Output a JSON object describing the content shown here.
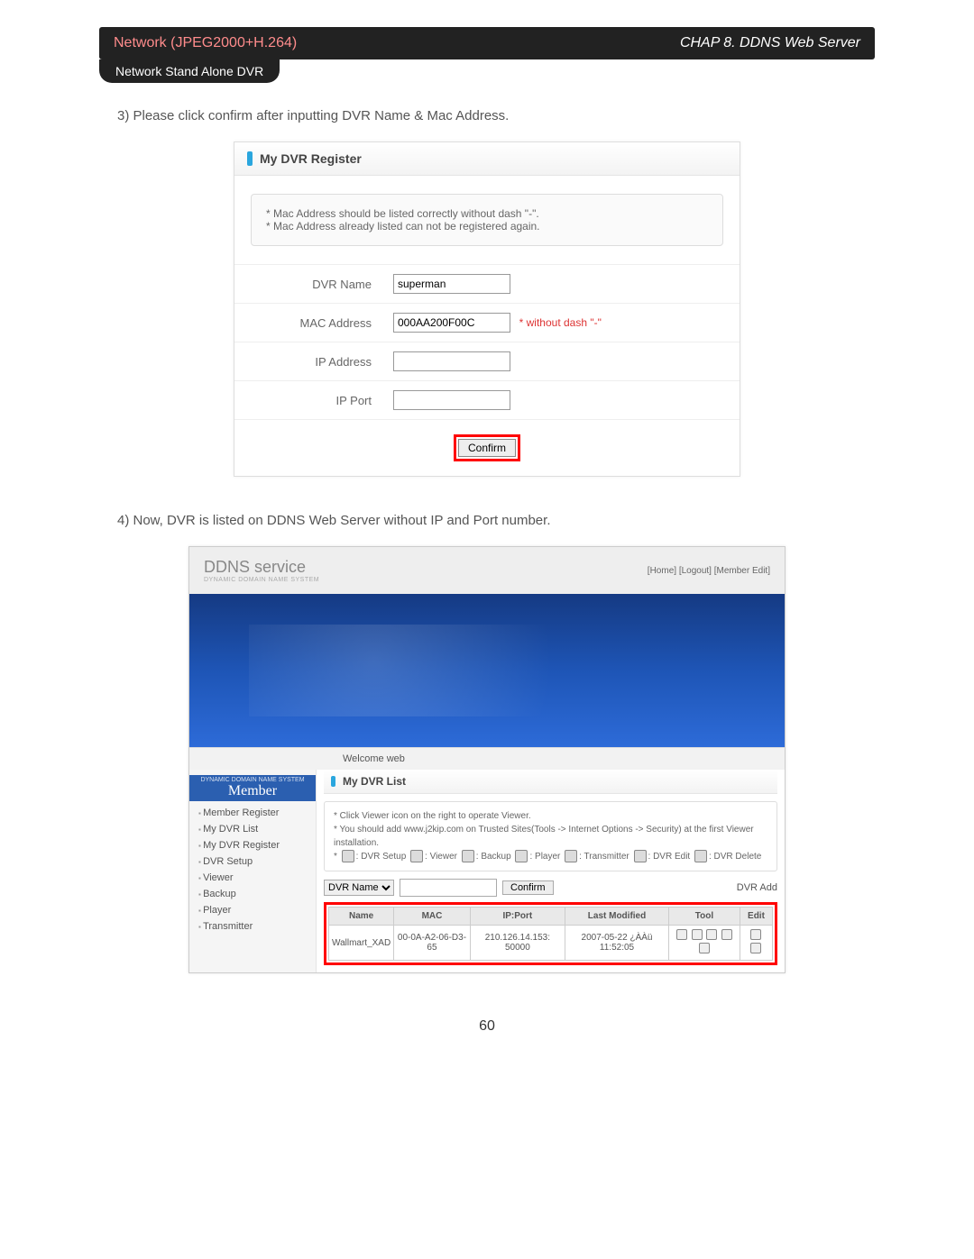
{
  "header": {
    "left": "Network (JPEG2000+H.264)",
    "right": "CHAP 8. DDNS Web Server",
    "pill": "Network Stand Alone DVR"
  },
  "instruction3": "3) Please click confirm after inputting DVR Name & Mac Address.",
  "instruction4": "4) Now, DVR is listed on DDNS Web Server without IP and Port number.",
  "fig1": {
    "title": "My DVR Register",
    "note1": "* Mac Address should be listed correctly without dash \"-\".",
    "note2": "* Mac Address already listed can not be registered again.",
    "labels": {
      "dvr_name": "DVR Name",
      "mac": "MAC Address",
      "ip": "IP Address",
      "port": "IP Port"
    },
    "values": {
      "dvr_name": "superman",
      "mac": "000AA200F00C",
      "ip": "",
      "port": ""
    },
    "mac_hint": "* without dash \"-\"",
    "confirm": "Confirm"
  },
  "fig2": {
    "logo_big": "DDNS service",
    "logo_sub": "DYNAMIC DOMAIN NAME SYSTEM",
    "menu": {
      "home": "[Home]",
      "logout": "[Logout]",
      "member_edit": "[Member Edit]"
    },
    "welcome": "Welcome web",
    "side_header_small": "DYNAMIC DOMAIN NAME SYSTEM",
    "side_header": "Member",
    "side_items": [
      "Member Register",
      "My DVR List",
      "My DVR Register",
      "DVR Setup",
      "Viewer",
      "Backup",
      "Player",
      "Transmitter"
    ],
    "list_title": "My DVR List",
    "legend_l1": "* Click Viewer icon on the right to operate Viewer.",
    "legend_l2": "* You should add www.j2kip.com on Trusted Sites(Tools -> Internet Options -> Security) at the first Viewer installation.",
    "legend_l3_prefix": "* ",
    "legend_icons": [
      ": DVR Setup ",
      ": Viewer ",
      ": Backup ",
      ": Player ",
      ": Transmitter ",
      ": DVR Edit ",
      ": DVR Delete"
    ],
    "search": {
      "by_label": "DVR Name",
      "confirm": "Confirm",
      "dvr_add": "DVR Add"
    },
    "cols": {
      "name": "Name",
      "mac": "MAC",
      "ipport": "IP:Port",
      "lm": "Last Modified",
      "tool": "Tool",
      "edit": "Edit"
    },
    "row": {
      "name": "Wallmart_XAD",
      "mac": "00-0A-A2-06-D3-65",
      "ipport": "210.126.14.153: 50000",
      "lm": "2007-05-22 ¿ÀÀü 11:52:05"
    }
  },
  "page_number": "60"
}
